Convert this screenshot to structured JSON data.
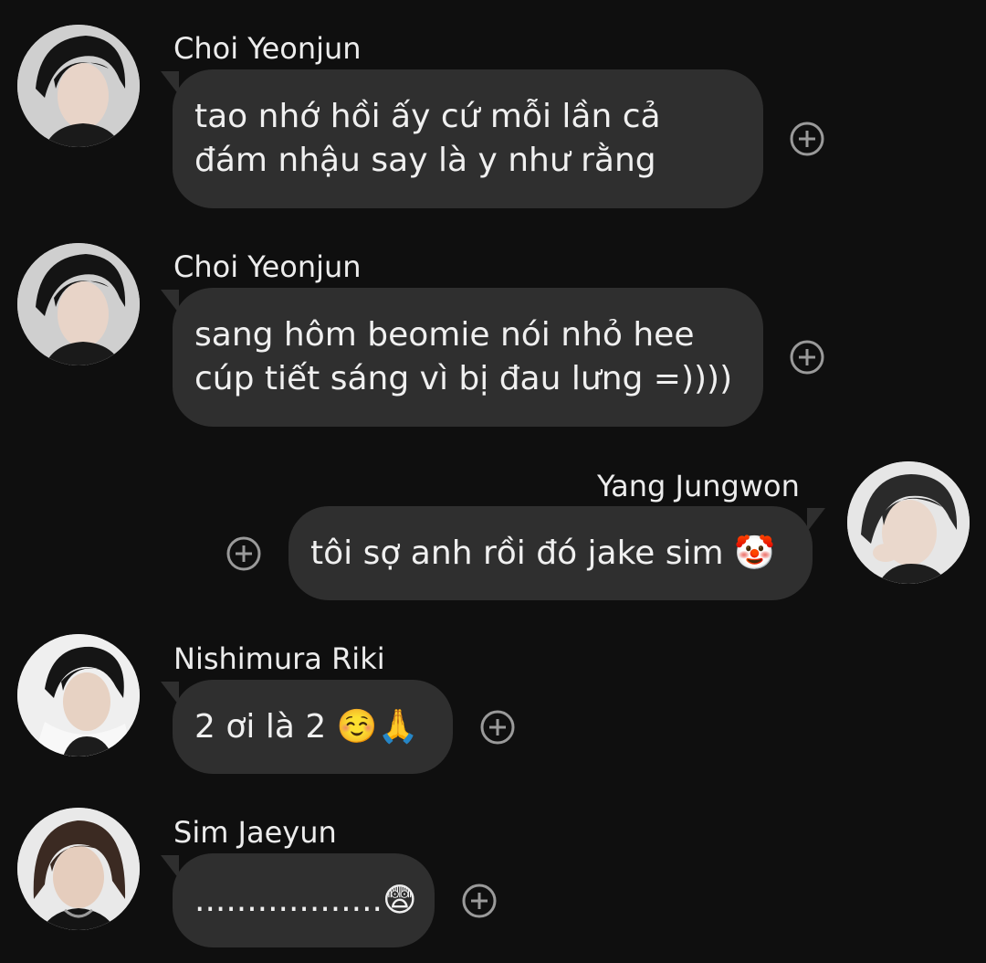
{
  "messages": [
    {
      "sender": "Choi Yeonjun",
      "lines": [
        "tao nhớ hồi ấy cứ mỗi lần cả",
        "đám nhậu say là y như rằng"
      ],
      "avatar_icon": "profile-photo"
    },
    {
      "sender": "Choi Yeonjun",
      "lines": [
        "sang hôm beomie nói nhỏ hee",
        "cúp tiết sáng vì bị đau lưng =))))"
      ],
      "avatar_icon": "profile-photo"
    },
    {
      "sender": "Yang Jungwon",
      "lines": [
        "tôi sợ anh rồi đó jake sim 🤡"
      ],
      "avatar_icon": "profile-photo"
    },
    {
      "sender": "Nishimura Riki",
      "lines": [
        "2 ơi là 2 ☺️🙏"
      ],
      "avatar_icon": "profile-photo"
    },
    {
      "sender": "Sim Jaeyun",
      "lines": [
        "..................😨"
      ],
      "avatar_icon": "profile-photo"
    }
  ],
  "icons": {
    "reaction": "add-reaction-icon"
  },
  "colors": {
    "background": "#0f0f0f",
    "bubble": "#2f2f2f",
    "text": "#f0f0f0",
    "icon": "#9a9a9a"
  }
}
